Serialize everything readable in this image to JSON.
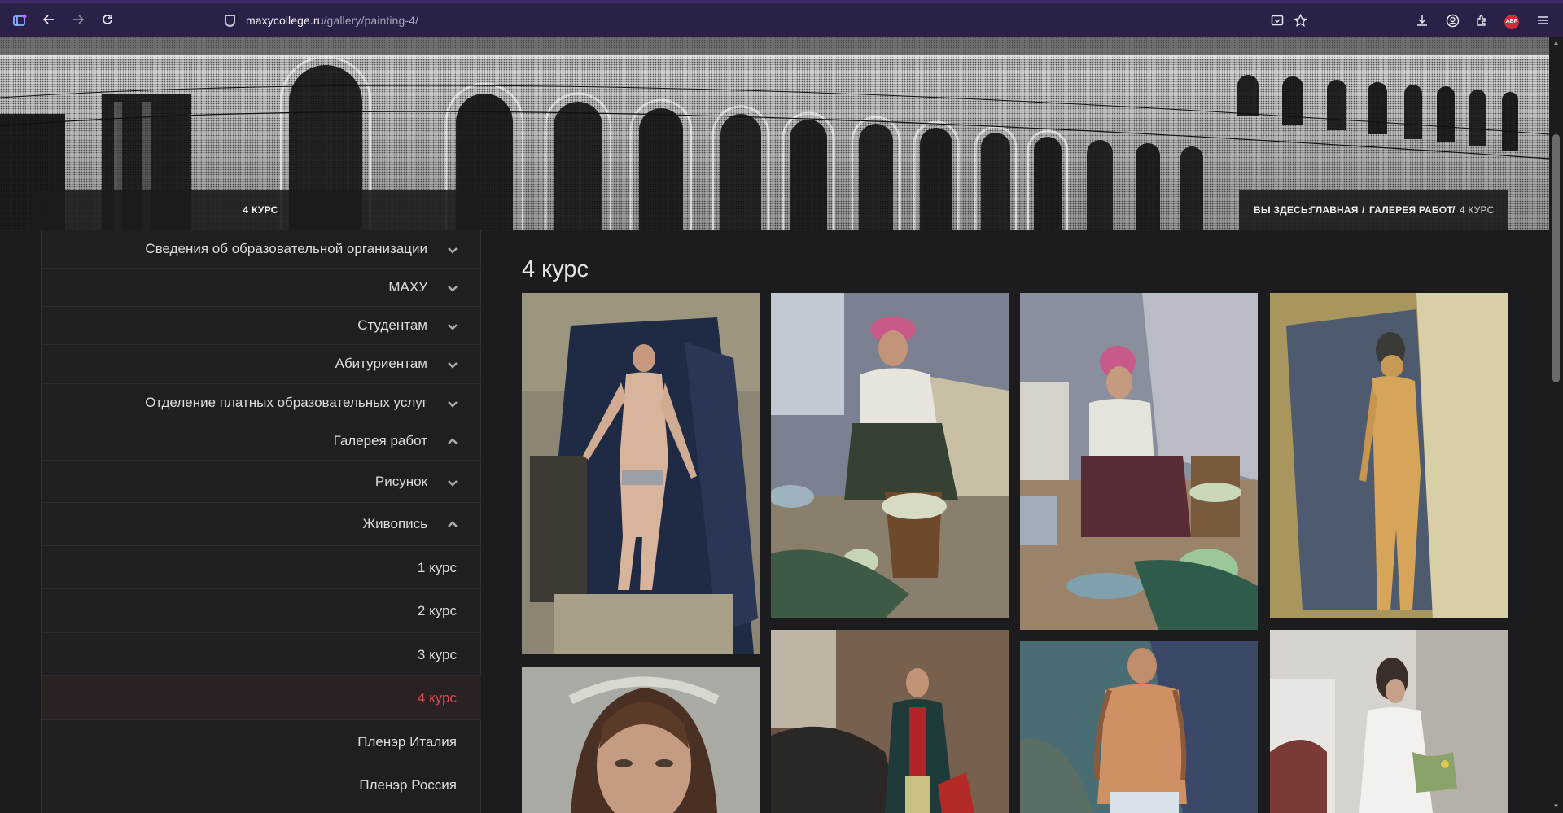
{
  "browser": {
    "url_domain": "maxycollege.ru",
    "url_path": "/gallery/painting-4/",
    "abp_label": "ABP"
  },
  "header": {
    "page_heading": "4 КУРС",
    "breadcrumb": {
      "prefix": "ВЫ ЗДЕСЬ:",
      "home": "ГЛАВНАЯ",
      "sep": "/",
      "gallery": "ГАЛЕРЕЯ РАБОТ",
      "current": "4 КУРС"
    }
  },
  "sidebar": {
    "items": [
      {
        "label": "Сведения об образовательной организации",
        "chevron": "down"
      },
      {
        "label": "МАХУ",
        "chevron": "down"
      },
      {
        "label": "Студентам",
        "chevron": "down"
      },
      {
        "label": "Абитуриентам",
        "chevron": "down"
      },
      {
        "label": "Отделение платных образовательных услуг",
        "chevron": "down"
      },
      {
        "label": "Галерея работ",
        "chevron": "up"
      },
      {
        "label": "Рисунок",
        "chevron": "down"
      },
      {
        "label": "Живопись",
        "chevron": "up"
      },
      {
        "label": "1 курс"
      },
      {
        "label": "2 курс"
      },
      {
        "label": "3 курс"
      },
      {
        "label": "4 курс",
        "active": true
      },
      {
        "label": "Пленэр Италия"
      },
      {
        "label": "Пленэр Россия"
      }
    ]
  },
  "main": {
    "title": "4 курс"
  },
  "colors": {
    "accent_active": "#d34b57",
    "browser_bar": "#2b2148",
    "page_bg": "#1c1c1e"
  },
  "icons": [
    "sidebar-toggle-icon",
    "back-icon",
    "forward-icon",
    "reload-icon",
    "shield-icon",
    "reader-view-icon",
    "bookmark-star-icon",
    "download-icon",
    "account-icon",
    "extensions-icon",
    "adblock-icon",
    "menu-icon"
  ]
}
